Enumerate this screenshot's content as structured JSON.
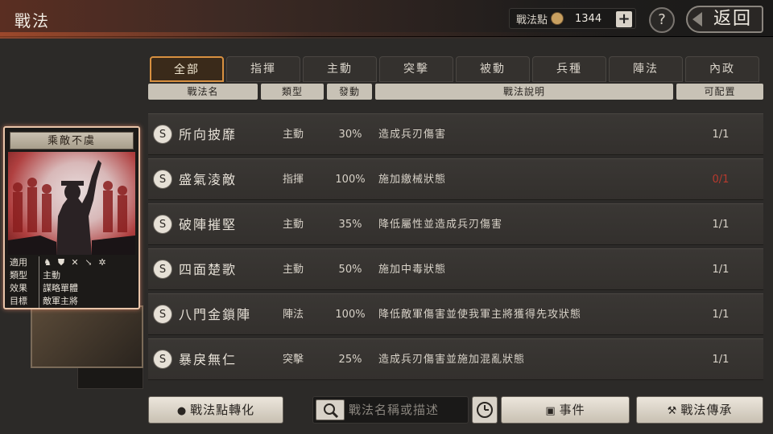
{
  "header": {
    "title": "戰法",
    "points_label": "戰法點",
    "points_value": "1344",
    "plus_label": "+",
    "help_label": "?",
    "back_label": "返回"
  },
  "tabs": [
    {
      "label": "全部",
      "active": true
    },
    {
      "label": "指揮",
      "active": false
    },
    {
      "label": "主動",
      "active": false
    },
    {
      "label": "突擊",
      "active": false
    },
    {
      "label": "被動",
      "active": false
    },
    {
      "label": "兵種",
      "active": false
    },
    {
      "label": "陣法",
      "active": false
    },
    {
      "label": "內政",
      "active": false
    }
  ],
  "columns": {
    "name": "戰法名",
    "type": "類型",
    "rate": "發動",
    "desc": "戰法說明",
    "slot": "可配置"
  },
  "rows": [
    {
      "grade": "S",
      "name": "所向披靡",
      "type": "主動",
      "rate": "30%",
      "desc": "造成兵刃傷害",
      "slot": "1/1",
      "slot_full": false
    },
    {
      "grade": "S",
      "name": "盛氣淩敵",
      "type": "指揮",
      "rate": "100%",
      "desc": "施加繳械狀態",
      "slot": "0/1",
      "slot_full": true
    },
    {
      "grade": "S",
      "name": "破陣摧堅",
      "type": "主動",
      "rate": "35%",
      "desc": "降低屬性並造成兵刃傷害",
      "slot": "1/1",
      "slot_full": false
    },
    {
      "grade": "S",
      "name": "四面楚歌",
      "type": "主動",
      "rate": "50%",
      "desc": "施加中毒狀態",
      "slot": "1/1",
      "slot_full": false
    },
    {
      "grade": "S",
      "name": "八門金鎖陣",
      "type": "陣法",
      "rate": "100%",
      "desc": "降低敵軍傷害並使我軍主將獲得先攻狀態",
      "slot": "1/1",
      "slot_full": false
    },
    {
      "grade": "S",
      "name": "暴戾無仁",
      "type": "突擊",
      "rate": "25%",
      "desc": "造成兵刃傷害並施加混亂狀態",
      "slot": "1/1",
      "slot_full": false
    }
  ],
  "card": {
    "title": "乘敵不虞",
    "info": {
      "applies_label": "適用",
      "applies_icons": [
        "cavalry-icon",
        "shield-icon",
        "bow-icon",
        "spear-icon",
        "wheel-icon"
      ],
      "type_label": "類型",
      "type_value": "主動",
      "effect_label": "效果",
      "effect_value": "謀略單體",
      "target_label": "目標",
      "target_value": "敵軍主將"
    }
  },
  "bottom": {
    "convert_label": "戰法點轉化",
    "search_placeholder": "戰法名稱或描述",
    "events_label": "事件",
    "inherit_label": "戰法傳承"
  },
  "colors": {
    "accent_tab": "#d89040",
    "slot_full": "#b83a2e",
    "card_border": "#e8c4a8"
  }
}
